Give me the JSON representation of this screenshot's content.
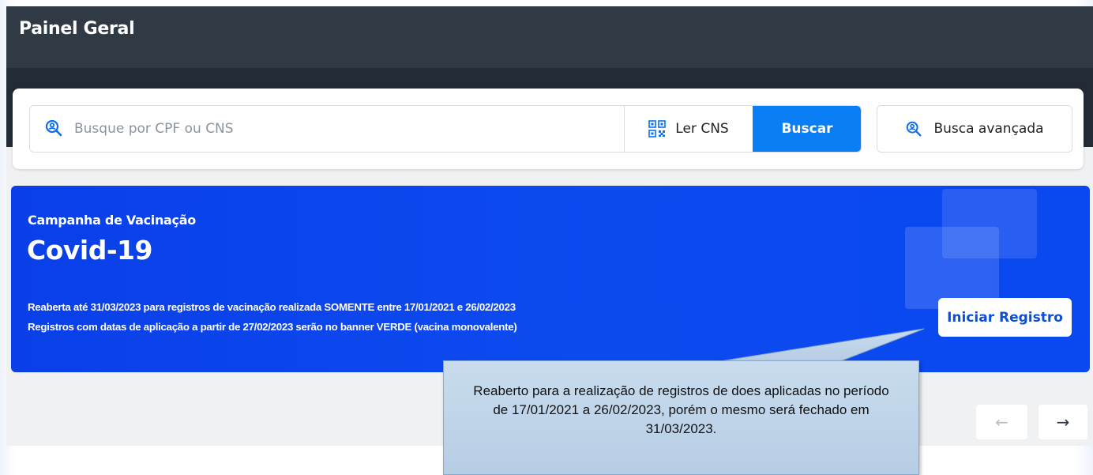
{
  "header": {
    "title": "Painel Geral"
  },
  "search": {
    "placeholder": "Busque por CPF ou CNS",
    "ler_cns_label": "Ler CNS",
    "buscar_label": "Buscar",
    "advanced_label": "Busca avançada"
  },
  "banner": {
    "subtitle": "Campanha de Vacinação",
    "title": "Covid-19",
    "line1": "Reaberta até 31/03/2023 para registros de vacinação realizada SOMENTE entre 17/01/2021 e 26/02/2023",
    "line2": "Registros com datas de aplicação a partir de 27/02/2023 serão no banner VERDE (vacina monovalente)",
    "button_label": "Iniciar Registro"
  },
  "carousel": {
    "prev_label": "←",
    "next_label": "→"
  },
  "callout": {
    "text": "Reaberto para a realização de registros de does aplicadas no período de 17/01/2021 a 26/02/2023, porém o mesmo será fechado em 31/03/2023."
  },
  "colors": {
    "header_bg": "#2f3a45",
    "accent_blue": "#0a7ff5",
    "banner_blue": "#0a3fe8",
    "callout_bg": "#c9dcee"
  },
  "icons": {
    "search": "search-person-icon",
    "qr": "qr-code-icon",
    "advanced": "search-person-icon",
    "prev": "arrow-left-icon",
    "next": "arrow-right-icon"
  }
}
